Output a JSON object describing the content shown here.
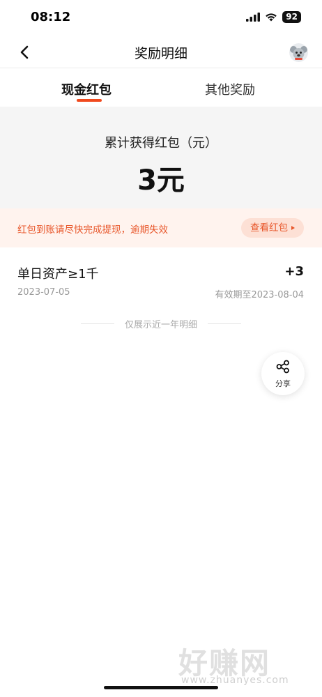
{
  "status_bar": {
    "time": "08:12",
    "battery": "92",
    "icons": [
      "signal-icon",
      "wifi-icon",
      "battery-icon"
    ]
  },
  "nav": {
    "title": "奖励明细",
    "back_icon": "back-arrow-icon",
    "avatar_icon": "koala-avatar-icon"
  },
  "tabs": [
    {
      "label": "现金红包",
      "active": true
    },
    {
      "label": "其他奖励",
      "active": false
    }
  ],
  "summary": {
    "label": "累计获得红包（元）",
    "amount": "3元"
  },
  "notice": {
    "text": "红包到账请尽快完成提现，逾期失效",
    "button_label": "查看红包"
  },
  "records": [
    {
      "title": "单日资产≥1千",
      "amount": "+3",
      "date": "2023-07-05",
      "expiry": "有效期至2023-08-04"
    }
  ],
  "footer_note": "仅展示近一年明细",
  "share": {
    "label": "分享",
    "icon": "share-icon"
  },
  "watermark": {
    "main": "好赚网",
    "sub": "www.zhuanyes.com"
  },
  "colors": {
    "accent": "#f04a1e",
    "notice_text": "#e8562a",
    "notice_bg": "#fff3ee",
    "summary_bg": "#f5f5f5"
  }
}
